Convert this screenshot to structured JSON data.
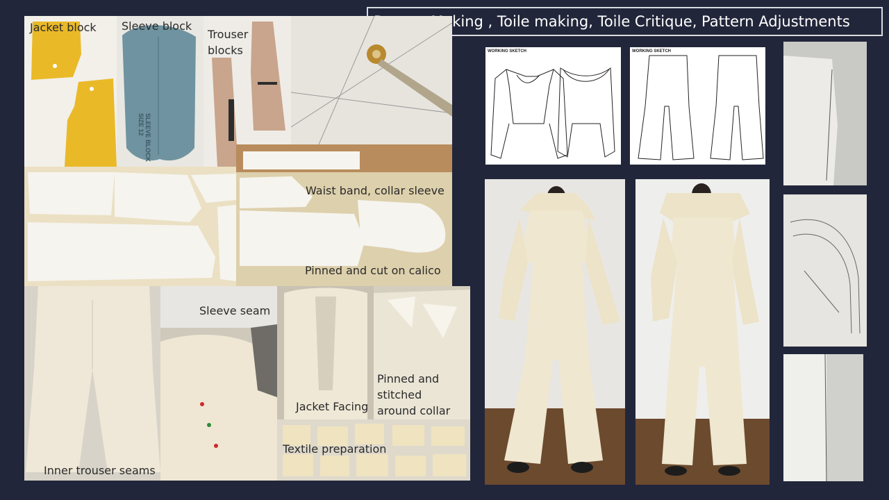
{
  "title": "Pattern Making , Toile making, Toile Critique, Pattern Adjustments",
  "labels": {
    "jacket_block": "Jacket block",
    "sleeve_block": "Sleeve block",
    "trouser_blocks_1": "Trouser",
    "trouser_blocks_2": "blocks",
    "waist_band": "Waist band, collar sleeve",
    "pinned_cut": "Pinned and cut on calico",
    "sleeve_seam": "Sleeve seam",
    "pinned_stitched_1": "Pinned and",
    "pinned_stitched_2": "stitched",
    "pinned_stitched_3": "around collar",
    "jacket_facing": "Jacket Facing",
    "textile_prep": "Textile preparation",
    "inner_trouser": "Inner trouser seams",
    "working_sketch_1": "WORKING SKETCH",
    "working_sketch_2": "WORKING SKETCH"
  },
  "block_texts": {
    "sleeve_block_1": "SLEEVE BLOCK",
    "sleeve_block_2": "SIZE 12"
  }
}
